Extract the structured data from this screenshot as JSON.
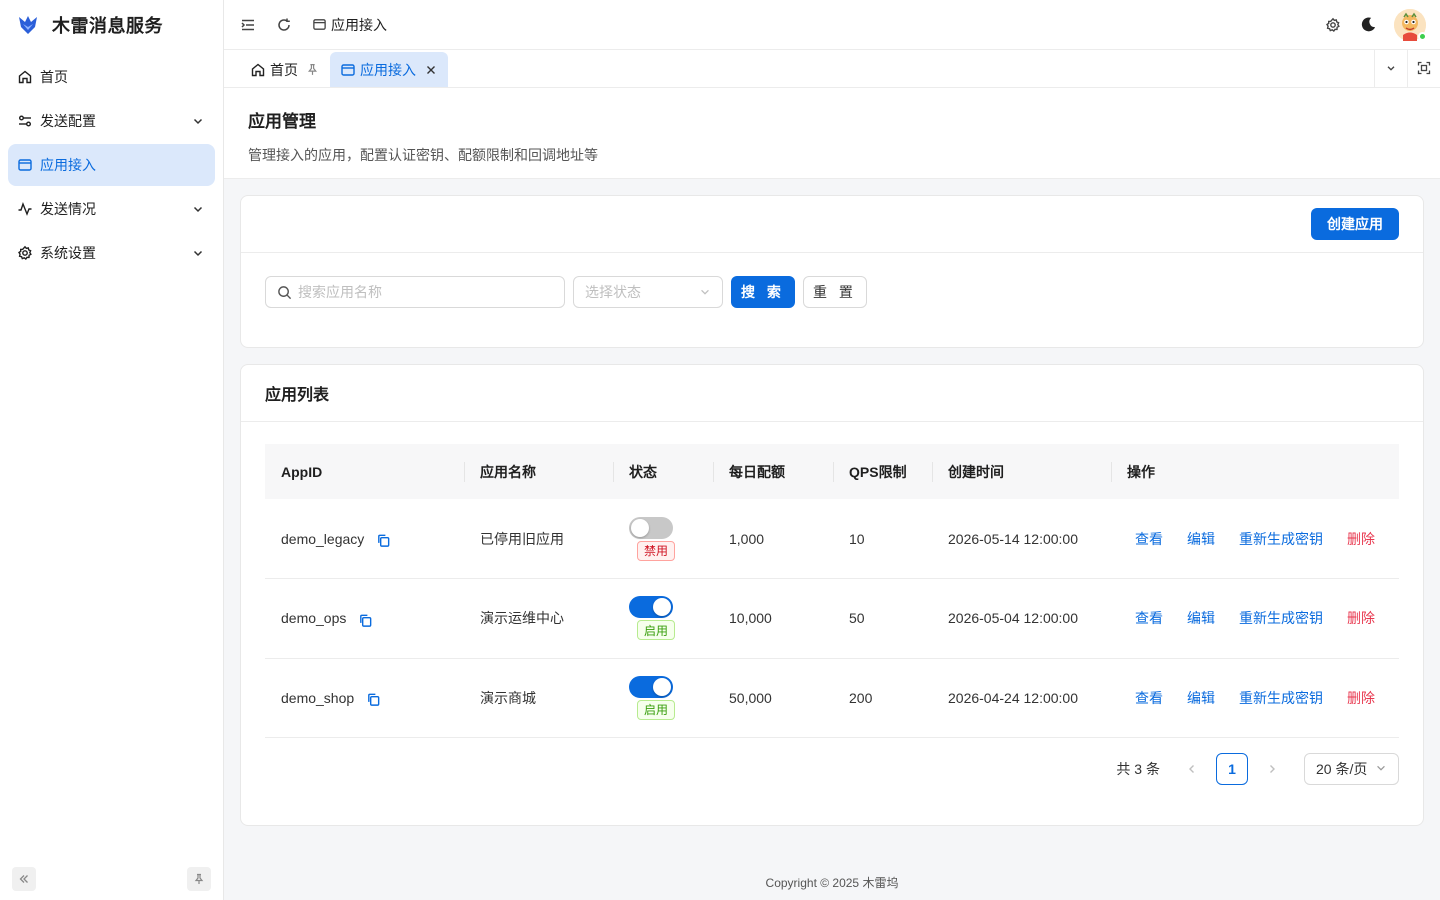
{
  "app": {
    "title": "木雷消息服务"
  },
  "sidebar": {
    "items": [
      {
        "label": "首页",
        "icon": "home-icon"
      },
      {
        "label": "发送配置",
        "icon": "sliders-icon"
      },
      {
        "label": "应用接入",
        "icon": "window-icon",
        "active": true
      },
      {
        "label": "发送情况",
        "icon": "activity-icon"
      },
      {
        "label": "系统设置",
        "icon": "gear-icon"
      }
    ]
  },
  "header": {
    "breadcrumb": "应用接入"
  },
  "tabs": [
    {
      "label": "首页"
    },
    {
      "label": "应用接入",
      "active": true
    }
  ],
  "page": {
    "title": "应用管理",
    "description": "管理接入的应用，配置认证密钥、配额限制和回调地址等"
  },
  "toolbar": {
    "create_label": "创建应用",
    "search_placeholder": "搜索应用名称",
    "status_placeholder": "选择状态",
    "search_label": "搜 索",
    "reset_label": "重 置"
  },
  "list": {
    "title": "应用列表",
    "columns": [
      "AppID",
      "应用名称",
      "状态",
      "每日配额",
      "QPS限制",
      "创建时间",
      "操作"
    ],
    "rows": [
      {
        "appid": "demo_legacy",
        "name": "已停用旧应用",
        "enabled": false,
        "status": "禁用",
        "quota": "1,000",
        "qps": "10",
        "created": "2026-05-14 12:00:00"
      },
      {
        "appid": "demo_ops",
        "name": "演示运维中心",
        "enabled": true,
        "status": "启用",
        "quota": "10,000",
        "qps": "50",
        "created": "2026-05-04 12:00:00"
      },
      {
        "appid": "demo_shop",
        "name": "演示商城",
        "enabled": true,
        "status": "启用",
        "quota": "50,000",
        "qps": "200",
        "created": "2026-04-24 12:00:00"
      }
    ],
    "actions": {
      "view": "查看",
      "edit": "编辑",
      "regen": "重新生成密钥",
      "delete": "删除"
    }
  },
  "pagination": {
    "total": "共 3 条",
    "current": "1",
    "page_size": "20 条/页"
  },
  "footer": {
    "text": "Copyright © 2025 木雷坞"
  },
  "colors": {
    "primary": "#0a6bde",
    "danger": "#e8384f",
    "active_bg": "#dbe8fb"
  }
}
